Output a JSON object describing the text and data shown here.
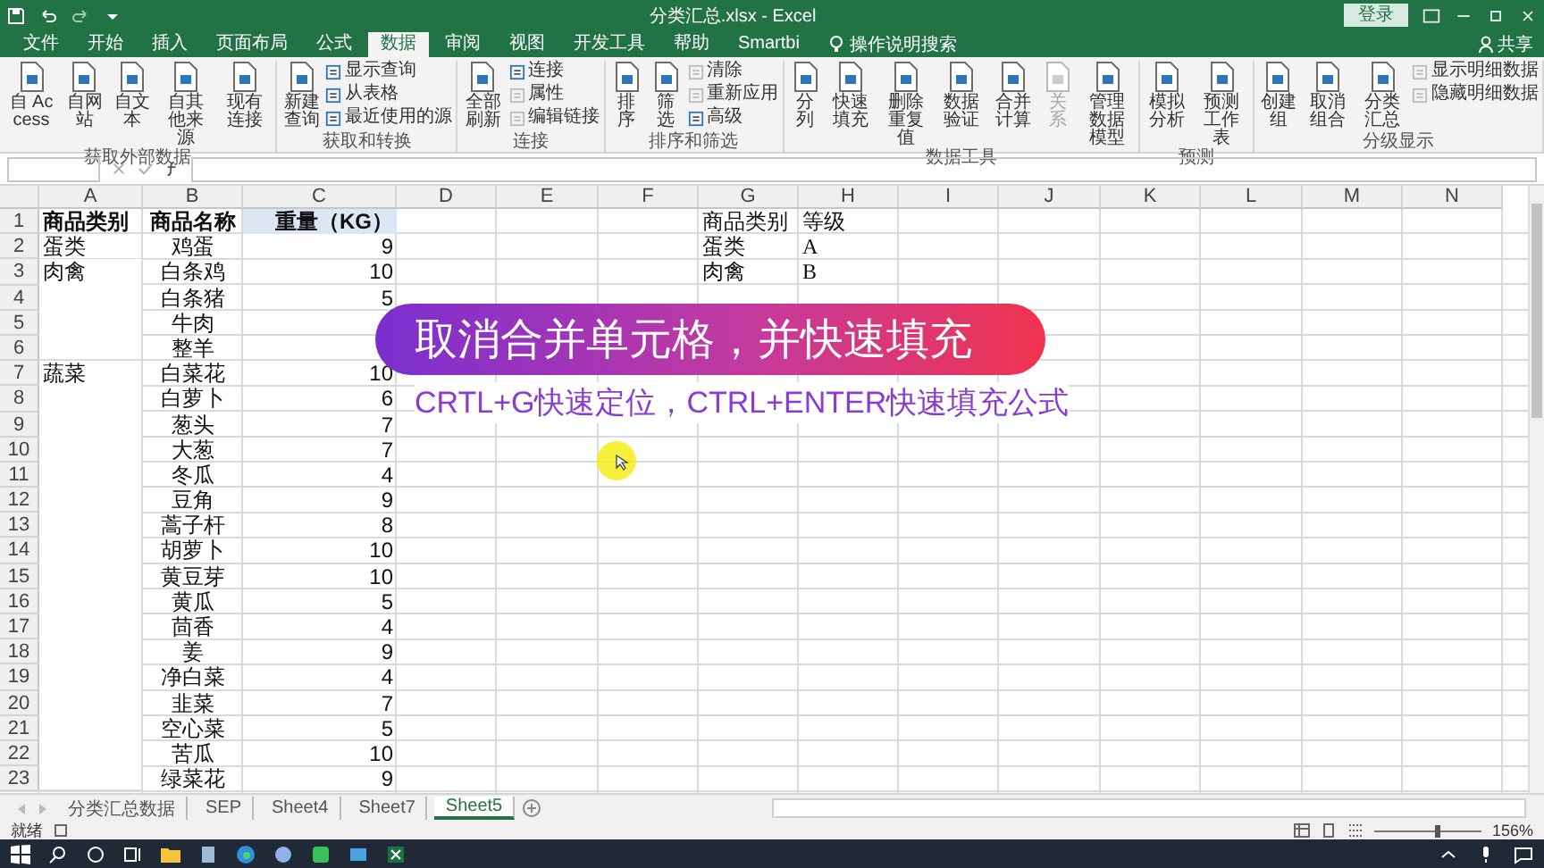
{
  "window": {
    "title": "分类汇总.xlsx - Excel",
    "signin": "登录"
  },
  "tabs": [
    {
      "label": "文件",
      "selected": false
    },
    {
      "label": "开始",
      "selected": false
    },
    {
      "label": "插入",
      "selected": false
    },
    {
      "label": "页面布局",
      "selected": false
    },
    {
      "label": "公式",
      "selected": false
    },
    {
      "label": "数据",
      "selected": true
    },
    {
      "label": "审阅",
      "selected": false
    },
    {
      "label": "视图",
      "selected": false
    },
    {
      "label": "开发工具",
      "selected": false
    },
    {
      "label": "帮助",
      "selected": false
    },
    {
      "label": "Smartbi",
      "selected": false
    }
  ],
  "tell_me": "操作说明搜索",
  "share": "共享",
  "ribbon": [
    {
      "label": "获取外部数据",
      "items": [
        {
          "kind": "large",
          "label": "自 Access",
          "disabled": false
        },
        {
          "kind": "large",
          "label": "自网站",
          "disabled": false
        },
        {
          "kind": "large",
          "label": "自文本",
          "disabled": false
        },
        {
          "kind": "large",
          "label": "自其他来源",
          "disabled": false
        },
        {
          "kind": "large",
          "label": "现有连接",
          "disabled": false
        }
      ]
    },
    {
      "label": "获取和转换",
      "items": [
        {
          "kind": "large",
          "label": "新建查询",
          "disabled": false
        },
        {
          "kind": "small",
          "label": "显示查询",
          "disabled": false
        },
        {
          "kind": "small",
          "label": "从表格",
          "disabled": false
        },
        {
          "kind": "small",
          "label": "最近使用的源",
          "disabled": false
        }
      ]
    },
    {
      "label": "连接",
      "items": [
        {
          "kind": "large",
          "label": "全部刷新",
          "disabled": false
        },
        {
          "kind": "small",
          "label": "连接",
          "disabled": false
        },
        {
          "kind": "small",
          "label": "属性",
          "disabled": true
        },
        {
          "kind": "small",
          "label": "编辑链接",
          "disabled": true
        }
      ]
    },
    {
      "label": "排序和筛选",
      "items": [
        {
          "kind": "large",
          "label": "排序",
          "disabled": false
        },
        {
          "kind": "large",
          "label": "筛选",
          "disabled": false
        },
        {
          "kind": "small",
          "label": "清除",
          "disabled": true
        },
        {
          "kind": "small",
          "label": "重新应用",
          "disabled": true
        },
        {
          "kind": "small",
          "label": "高级",
          "disabled": false
        }
      ]
    },
    {
      "label": "数据工具",
      "items": [
        {
          "kind": "large",
          "label": "分列",
          "disabled": false
        },
        {
          "kind": "large",
          "label": "快速填充",
          "disabled": false
        },
        {
          "kind": "large",
          "label": "删除重复值",
          "disabled": false
        },
        {
          "kind": "large",
          "label": "数据验证",
          "disabled": false
        },
        {
          "kind": "large",
          "label": "合并计算",
          "disabled": false
        },
        {
          "kind": "large",
          "label": "关系",
          "disabled": true
        },
        {
          "kind": "large",
          "label": "管理数据模型",
          "disabled": false
        }
      ]
    },
    {
      "label": "预测",
      "items": [
        {
          "kind": "large",
          "label": "模拟分析",
          "disabled": false
        },
        {
          "kind": "large",
          "label": "预测工作表",
          "disabled": false
        }
      ]
    },
    {
      "label": "分级显示",
      "items": [
        {
          "kind": "large",
          "label": "创建组",
          "disabled": false
        },
        {
          "kind": "large",
          "label": "取消组合",
          "disabled": false
        },
        {
          "kind": "large",
          "label": "分类汇总",
          "disabled": false
        },
        {
          "kind": "small",
          "label": "显示明细数据",
          "disabled": true
        },
        {
          "kind": "small",
          "label": "隐藏明细数据",
          "disabled": true
        }
      ]
    }
  ],
  "sheet": {
    "columns": [
      {
        "label": "A"
      },
      {
        "label": "B"
      },
      {
        "label": "C"
      },
      {
        "label": "D"
      },
      {
        "label": "E"
      },
      {
        "label": "F"
      },
      {
        "label": "G"
      },
      {
        "label": "H"
      },
      {
        "label": "I"
      },
      {
        "label": "J"
      },
      {
        "label": "K"
      },
      {
        "label": "L"
      },
      {
        "label": "M"
      },
      {
        "label": "N"
      }
    ],
    "rows": [
      {
        "n": "1",
        "cells": {
          "A": {
            "text": "商品类别",
            "bold": true
          },
          "B": {
            "text": "商品名称",
            "bold": true
          },
          "C": {
            "text": "重量（KG）",
            "bold": true,
            "highlighted": true
          },
          "G": {
            "text": "商品类别"
          },
          "H": {
            "text": "等级"
          }
        }
      },
      {
        "n": "2",
        "cells": {
          "A": {
            "text": "蛋类"
          },
          "B": {
            "text": "鸡蛋"
          },
          "C": {
            "text": "9"
          },
          "G": {
            "text": "蛋类"
          },
          "H": {
            "text": "A"
          }
        }
      },
      {
        "n": "3",
        "cells": {
          "A": {
            "text": "肉禽",
            "merged": true
          },
          "B": {
            "text": "白条鸡"
          },
          "C": {
            "text": "10"
          },
          "G": {
            "text": "肉禽"
          },
          "H": {
            "text": "B"
          }
        }
      },
      {
        "n": "4",
        "cells": {
          "B": {
            "text": "白条猪"
          },
          "C": {
            "text": "5"
          }
        }
      },
      {
        "n": "5",
        "cells": {
          "B": {
            "text": "牛肉"
          }
        }
      },
      {
        "n": "6",
        "cells": {
          "B": {
            "text": "整羊"
          }
        }
      },
      {
        "n": "7",
        "cells": {
          "A": {
            "text": "蔬菜",
            "merged": true
          },
          "B": {
            "text": "白菜花"
          },
          "C": {
            "text": "10"
          }
        }
      },
      {
        "n": "8",
        "cells": {
          "B": {
            "text": "白萝卜"
          },
          "C": {
            "text": "6"
          }
        }
      },
      {
        "n": "9",
        "cells": {
          "B": {
            "text": "葱头"
          },
          "C": {
            "text": "7"
          }
        }
      },
      {
        "n": "10",
        "cells": {
          "B": {
            "text": "大葱"
          },
          "C": {
            "text": "7"
          }
        }
      },
      {
        "n": "11",
        "cells": {
          "B": {
            "text": "冬瓜"
          },
          "C": {
            "text": "4"
          }
        }
      },
      {
        "n": "12",
        "cells": {
          "B": {
            "text": "豆角"
          },
          "C": {
            "text": "9"
          }
        }
      },
      {
        "n": "13",
        "cells": {
          "B": {
            "text": "蒿子杆"
          },
          "C": {
            "text": "8"
          }
        }
      },
      {
        "n": "14",
        "cells": {
          "B": {
            "text": "胡萝卜"
          },
          "C": {
            "text": "10"
          }
        }
      },
      {
        "n": "15",
        "cells": {
          "B": {
            "text": "黄豆芽"
          },
          "C": {
            "text": "10"
          }
        }
      },
      {
        "n": "16",
        "cells": {
          "B": {
            "text": "黄瓜"
          },
          "C": {
            "text": "5"
          }
        }
      },
      {
        "n": "17",
        "cells": {
          "B": {
            "text": "茴香"
          },
          "C": {
            "text": "4"
          }
        }
      },
      {
        "n": "18",
        "cells": {
          "B": {
            "text": "姜"
          },
          "C": {
            "text": "9"
          }
        }
      },
      {
        "n": "19",
        "cells": {
          "B": {
            "text": "净白菜"
          },
          "C": {
            "text": "4"
          }
        }
      },
      {
        "n": "20",
        "cells": {
          "B": {
            "text": "韭菜"
          },
          "C": {
            "text": "7"
          }
        }
      },
      {
        "n": "21",
        "cells": {
          "B": {
            "text": "空心菜"
          },
          "C": {
            "text": "5"
          }
        }
      },
      {
        "n": "22",
        "cells": {
          "B": {
            "text": "苦瓜"
          },
          "C": {
            "text": "10"
          }
        }
      },
      {
        "n": "23",
        "cells": {
          "B": {
            "text": "绿菜花"
          },
          "C": {
            "text": "9"
          }
        }
      }
    ]
  },
  "captions": [
    {
      "kind": "banner",
      "text": "取消合并单元格，并快速填充"
    },
    {
      "kind": "subtitle",
      "text": "CRTL+G快速定位，CTRL+ENTER快速填充公式"
    }
  ],
  "sheet_tabs": [
    {
      "label": "分类汇总数据",
      "selected": false
    },
    {
      "label": "SEP",
      "selected": false
    },
    {
      "label": "Sheet4",
      "selected": false
    },
    {
      "label": "Sheet7",
      "selected": false
    },
    {
      "label": "Sheet5",
      "selected": true
    }
  ],
  "status": {
    "text": "就绪",
    "zoom": "156%",
    "zoom_slider": {
      "level": 0.6
    }
  }
}
